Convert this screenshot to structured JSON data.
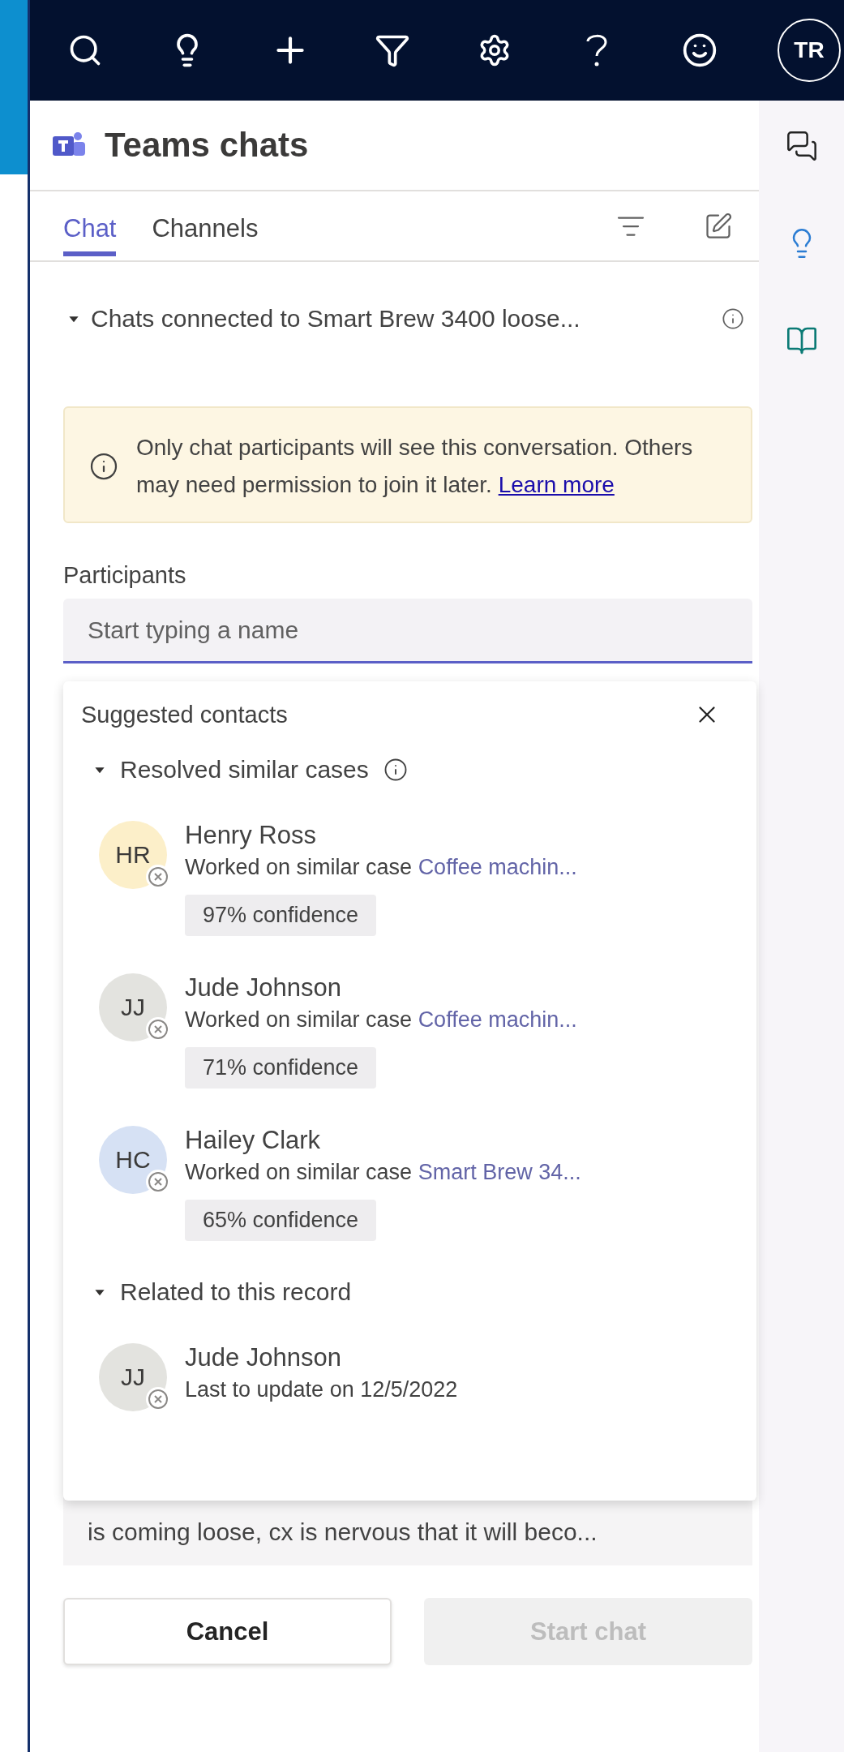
{
  "top_bar": {
    "avatar": "TR"
  },
  "panel": {
    "title": "Teams chats"
  },
  "tabs": [
    {
      "label": "Chat",
      "selected": true
    },
    {
      "label": "Channels",
      "selected": false
    }
  ],
  "section": {
    "label": "Chats connected to Smart Brew 3400 loose...",
    "expanded": true
  },
  "notice": {
    "text": "Only chat participants will see this conversation. Others may need permission to join it later.",
    "link": "Learn more"
  },
  "participants": {
    "label": "Participants",
    "placeholder": "Start typing a name"
  },
  "suggestions": {
    "title": "Suggested contacts",
    "groups": [
      {
        "label": "Resolved similar cases",
        "expanded": true,
        "info": true,
        "contacts": [
          {
            "initials": "HR",
            "color": "#fcefc9",
            "name": "Henry Ross",
            "detail": "Worked on similar case",
            "link": "Coffee machin...",
            "confidence": "97% confidence"
          },
          {
            "initials": "JJ",
            "color": "#e3e3df",
            "name": "Jude Johnson",
            "detail": "Worked on similar case",
            "link": "Coffee machin...",
            "confidence": "71% confidence"
          },
          {
            "initials": "HC",
            "color": "#d6e1f4",
            "name": "Hailey Clark",
            "detail": "Worked on similar case",
            "link": "Smart Brew 34...",
            "confidence": "65% confidence"
          }
        ]
      },
      {
        "label": "Related to this record",
        "expanded": true,
        "info": false,
        "contacts": [
          {
            "initials": "JJ",
            "color": "#e3e3df",
            "name": "Jude Johnson",
            "detail": "Last to update on 12/5/2022"
          }
        ]
      }
    ]
  },
  "description": {
    "value": "is coming loose, cx is nervous that it will beco..."
  },
  "buttons": [
    {
      "label": "Cancel",
      "disabled": false
    },
    {
      "label": "Start chat",
      "disabled": true
    }
  ]
}
